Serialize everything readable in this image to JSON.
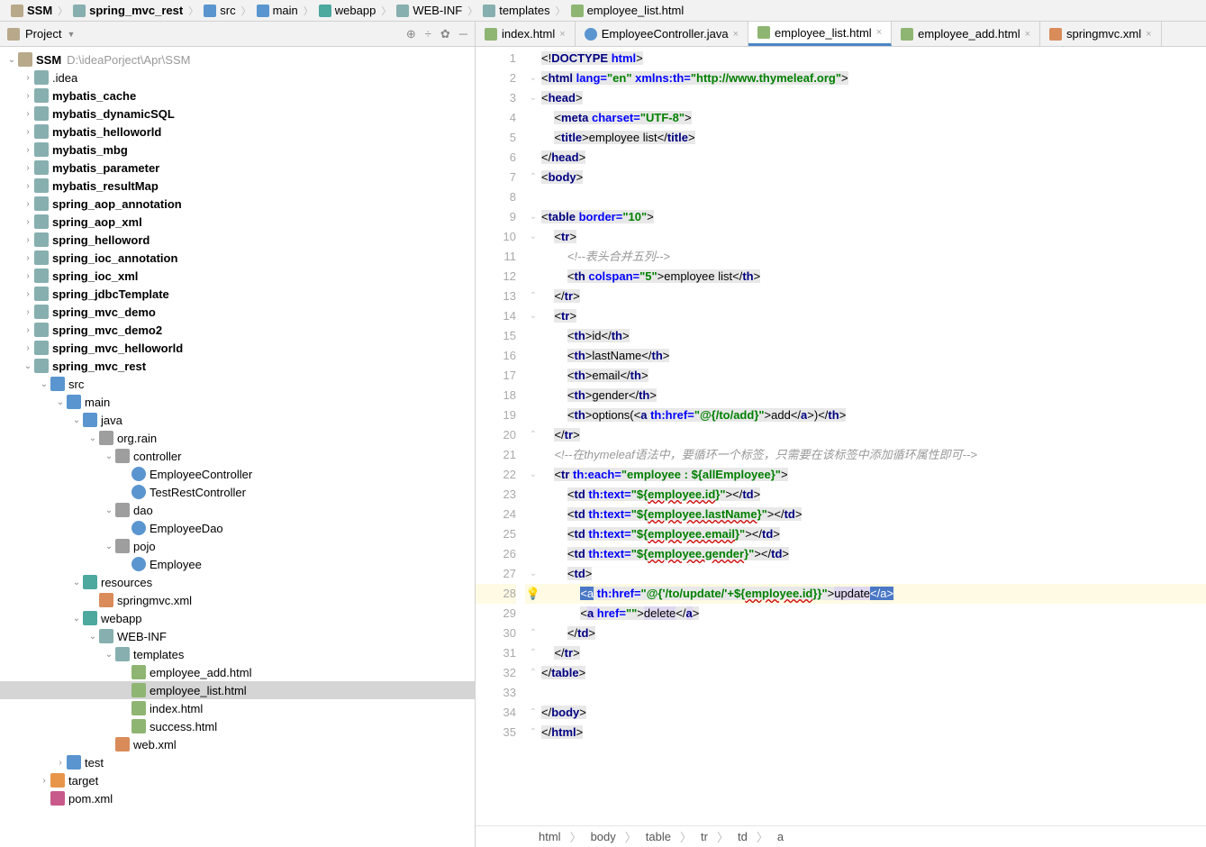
{
  "breadcrumb": [
    {
      "label": "SSM",
      "icon": "ic-fld",
      "bold": true
    },
    {
      "label": "spring_mvc_rest",
      "icon": "ic-fldo",
      "bold": true
    },
    {
      "label": "src",
      "icon": "ic-fldb"
    },
    {
      "label": "main",
      "icon": "ic-fldb"
    },
    {
      "label": "webapp",
      "icon": "ic-fldt"
    },
    {
      "label": "WEB-INF",
      "icon": "ic-fldo"
    },
    {
      "label": "templates",
      "icon": "ic-fldo"
    },
    {
      "label": "employee_list.html",
      "icon": "ic-html"
    }
  ],
  "project_label": "Project",
  "toolbar_icons": [
    "target-icon",
    "collapse-icon",
    "gear-icon",
    "hide-icon"
  ],
  "tabs": [
    {
      "label": "index.html",
      "icon": "ic-html",
      "active": false
    },
    {
      "label": "EmployeeController.java",
      "icon": "ic-cls",
      "active": false
    },
    {
      "label": "employee_list.html",
      "icon": "ic-html",
      "active": true
    },
    {
      "label": "employee_add.html",
      "icon": "ic-html",
      "active": false
    },
    {
      "label": "springmvc.xml",
      "icon": "ic-xml",
      "active": false
    }
  ],
  "tree": [
    {
      "d": 0,
      "ar": "v",
      "ic": "ic-fld",
      "lbl": "SSM",
      "bold": true,
      "dim": "D:\\ideaPorject\\Apr\\SSM"
    },
    {
      "d": 1,
      "ar": ">",
      "ic": "ic-fldo",
      "lbl": ".idea"
    },
    {
      "d": 1,
      "ar": ">",
      "ic": "ic-fldo",
      "lbl": "mybatis_cache",
      "bold": true
    },
    {
      "d": 1,
      "ar": ">",
      "ic": "ic-fldo",
      "lbl": "mybatis_dynamicSQL",
      "bold": true
    },
    {
      "d": 1,
      "ar": ">",
      "ic": "ic-fldo",
      "lbl": "mybatis_helloworld",
      "bold": true
    },
    {
      "d": 1,
      "ar": ">",
      "ic": "ic-fldo",
      "lbl": "mybatis_mbg",
      "bold": true
    },
    {
      "d": 1,
      "ar": ">",
      "ic": "ic-fldo",
      "lbl": "mybatis_parameter",
      "bold": true
    },
    {
      "d": 1,
      "ar": ">",
      "ic": "ic-fldo",
      "lbl": "mybatis_resultMap",
      "bold": true
    },
    {
      "d": 1,
      "ar": ">",
      "ic": "ic-fldo",
      "lbl": "spring_aop_annotation",
      "bold": true
    },
    {
      "d": 1,
      "ar": ">",
      "ic": "ic-fldo",
      "lbl": "spring_aop_xml",
      "bold": true
    },
    {
      "d": 1,
      "ar": ">",
      "ic": "ic-fldo",
      "lbl": "spring_helloword",
      "bold": true
    },
    {
      "d": 1,
      "ar": ">",
      "ic": "ic-fldo",
      "lbl": "spring_ioc_annotation",
      "bold": true
    },
    {
      "d": 1,
      "ar": ">",
      "ic": "ic-fldo",
      "lbl": "spring_ioc_xml",
      "bold": true
    },
    {
      "d": 1,
      "ar": ">",
      "ic": "ic-fldo",
      "lbl": "spring_jdbcTemplate",
      "bold": true
    },
    {
      "d": 1,
      "ar": ">",
      "ic": "ic-fldo",
      "lbl": "spring_mvc_demo",
      "bold": true
    },
    {
      "d": 1,
      "ar": ">",
      "ic": "ic-fldo",
      "lbl": "spring_mvc_demo2",
      "bold": true
    },
    {
      "d": 1,
      "ar": ">",
      "ic": "ic-fldo",
      "lbl": "spring_mvc_helloworld",
      "bold": true
    },
    {
      "d": 1,
      "ar": "v",
      "ic": "ic-fldo",
      "lbl": "spring_mvc_rest",
      "bold": true
    },
    {
      "d": 2,
      "ar": "v",
      "ic": "ic-fldb",
      "lbl": "src"
    },
    {
      "d": 3,
      "ar": "v",
      "ic": "ic-fldb",
      "lbl": "main"
    },
    {
      "d": 4,
      "ar": "v",
      "ic": "ic-fldb",
      "lbl": "java"
    },
    {
      "d": 5,
      "ar": "v",
      "ic": "ic-fldg",
      "lbl": "org.rain"
    },
    {
      "d": 6,
      "ar": "v",
      "ic": "ic-fldg",
      "lbl": "controller"
    },
    {
      "d": 7,
      "ar": "",
      "ic": "ic-cls",
      "lbl": "EmployeeController"
    },
    {
      "d": 7,
      "ar": "",
      "ic": "ic-cls",
      "lbl": "TestRestController"
    },
    {
      "d": 6,
      "ar": "v",
      "ic": "ic-fldg",
      "lbl": "dao"
    },
    {
      "d": 7,
      "ar": "",
      "ic": "ic-cls",
      "lbl": "EmployeeDao"
    },
    {
      "d": 6,
      "ar": "v",
      "ic": "ic-fldg",
      "lbl": "pojo"
    },
    {
      "d": 7,
      "ar": "",
      "ic": "ic-cls",
      "lbl": "Employee"
    },
    {
      "d": 4,
      "ar": "v",
      "ic": "ic-fldt",
      "lbl": "resources"
    },
    {
      "d": 5,
      "ar": "",
      "ic": "ic-xml",
      "lbl": "springmvc.xml"
    },
    {
      "d": 4,
      "ar": "v",
      "ic": "ic-fldt",
      "lbl": "webapp"
    },
    {
      "d": 5,
      "ar": "v",
      "ic": "ic-fldo",
      "lbl": "WEB-INF"
    },
    {
      "d": 6,
      "ar": "v",
      "ic": "ic-fldo",
      "lbl": "templates"
    },
    {
      "d": 7,
      "ar": "",
      "ic": "ic-html",
      "lbl": "employee_add.html"
    },
    {
      "d": 7,
      "ar": "",
      "ic": "ic-html",
      "lbl": "employee_list.html",
      "sel": true
    },
    {
      "d": 7,
      "ar": "",
      "ic": "ic-html",
      "lbl": "index.html"
    },
    {
      "d": 7,
      "ar": "",
      "ic": "ic-html",
      "lbl": "success.html"
    },
    {
      "d": 6,
      "ar": "",
      "ic": "ic-xml",
      "lbl": "web.xml"
    },
    {
      "d": 3,
      "ar": ">",
      "ic": "ic-fldb",
      "lbl": "test"
    },
    {
      "d": 2,
      "ar": ">",
      "ic": "ic-fldor",
      "lbl": "target"
    },
    {
      "d": 2,
      "ar": "",
      "ic": "ic-m",
      "lbl": "pom.xml"
    }
  ],
  "line_count": 35,
  "highlighted_line": 28,
  "status": [
    "html",
    "body",
    "table",
    "tr",
    "td",
    "a"
  ]
}
